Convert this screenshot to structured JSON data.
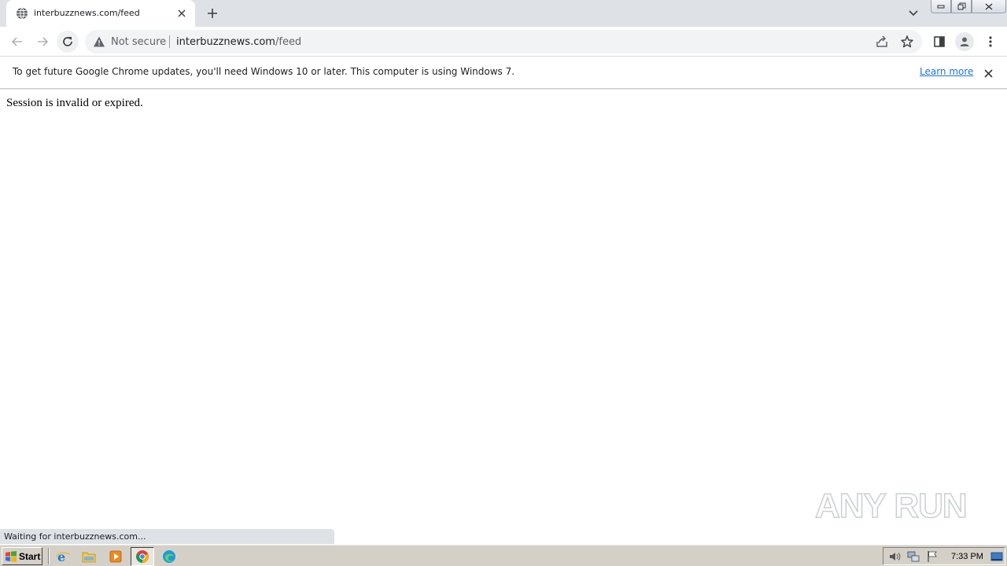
{
  "browser": {
    "tab": {
      "title": "interbuzznews.com/feed"
    },
    "omnibox": {
      "security_label": "Not secure",
      "url_host": "interbuzznews.com",
      "url_path": "/feed"
    },
    "infobar": {
      "message": "To get future Google Chrome updates, you'll need Windows 10 or later. This computer is using Windows 7.",
      "link_label": "Learn more"
    },
    "status_bar": "Waiting for interbuzznews.com..."
  },
  "page": {
    "message": "Session is invalid or expired."
  },
  "watermark": {
    "text": "ANY RUN"
  },
  "taskbar": {
    "start_label": "Start",
    "clock": "7:33 PM",
    "apps": [
      "internet-explorer-icon",
      "file-explorer-icon",
      "media-player-icon",
      "chrome-icon",
      "edge-icon"
    ]
  },
  "colors": {
    "tabstrip_bg": "#dee1e6",
    "omnibox_bg": "#f1f3f4",
    "link": "#1a73e8",
    "taskbar_bg": "#d4d0c8"
  }
}
